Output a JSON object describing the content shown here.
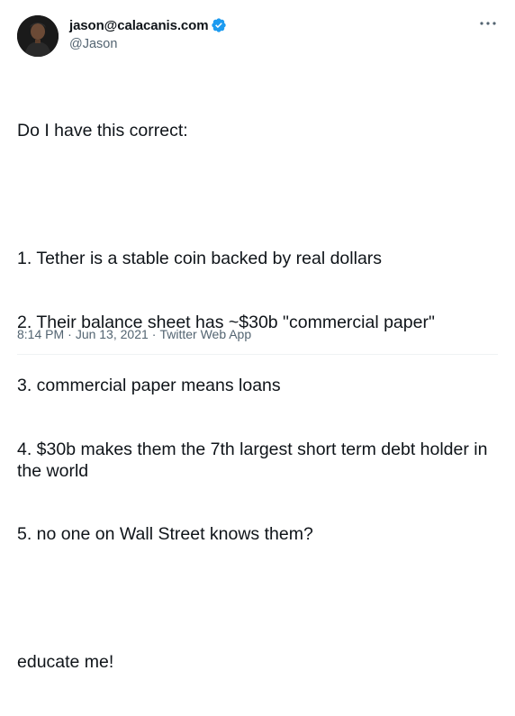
{
  "author": {
    "display_name": "jason@calacanis.com",
    "handle": "@Jason",
    "verified": true
  },
  "tweet": {
    "lines": [
      "Do I have this correct:",
      "",
      "1. Tether is a stable coin backed by real dollars",
      "2. Their balance sheet has ~$30b \"commercial paper\"",
      "3. commercial paper means loans",
      "4. $30b makes them the 7th largest short term debt holder in the world",
      "5. no one on Wall Street knows them?",
      "",
      "educate me!"
    ]
  },
  "meta": {
    "time": "8:14 PM",
    "separator": "·",
    "date": "Jun 13, 2021",
    "source": "Twitter Web App"
  },
  "icons": {
    "verified": "verified-badge-icon",
    "more": "more-horizontal-icon"
  },
  "colors": {
    "verified": "#1d9bf0",
    "text": "#0f1419",
    "secondary": "#536471"
  }
}
